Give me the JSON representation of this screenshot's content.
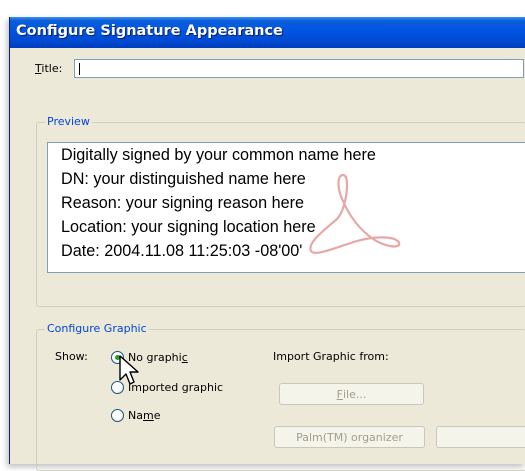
{
  "dialog": {
    "title": "Configure Signature Appearance"
  },
  "title_field": {
    "label": "Title",
    "label_mnemonic": "T",
    "label_rest": "itle:",
    "value": ""
  },
  "preview": {
    "legend": "Preview",
    "lines": [
      "Digitally signed by your common name here",
      "DN: your distinguished name here",
      "Reason: your signing reason here",
      "Location: your signing location here",
      "Date: 2004.11.08 11:25:03 -08'00'"
    ],
    "watermark_icon": "adobe-pdf-logo",
    "watermark_color": "#e8a6a6"
  },
  "configure_graphic": {
    "legend": "Configure Graphic",
    "show_label": "Show:",
    "options": [
      {
        "label_before": "No graphi",
        "label_mnemonic": "c",
        "label_after": "",
        "selected": true
      },
      {
        "label_before": "Imported graphic",
        "label_mnemonic": "",
        "label_after": "",
        "selected": false
      },
      {
        "label_before": "Na",
        "label_mnemonic": "m",
        "label_after": "e",
        "selected": false
      }
    ],
    "import_label": "Import Graphic from:",
    "file_button": {
      "mnemonic": "F",
      "rest": "ile..."
    },
    "palm_button": "Palm(TM) organizer"
  },
  "colors": {
    "titlebar": "#0054e3",
    "dialog_bg": "#ece9d8",
    "legend_text": "#0046d5",
    "radio_selected_dot": "#21a121"
  }
}
